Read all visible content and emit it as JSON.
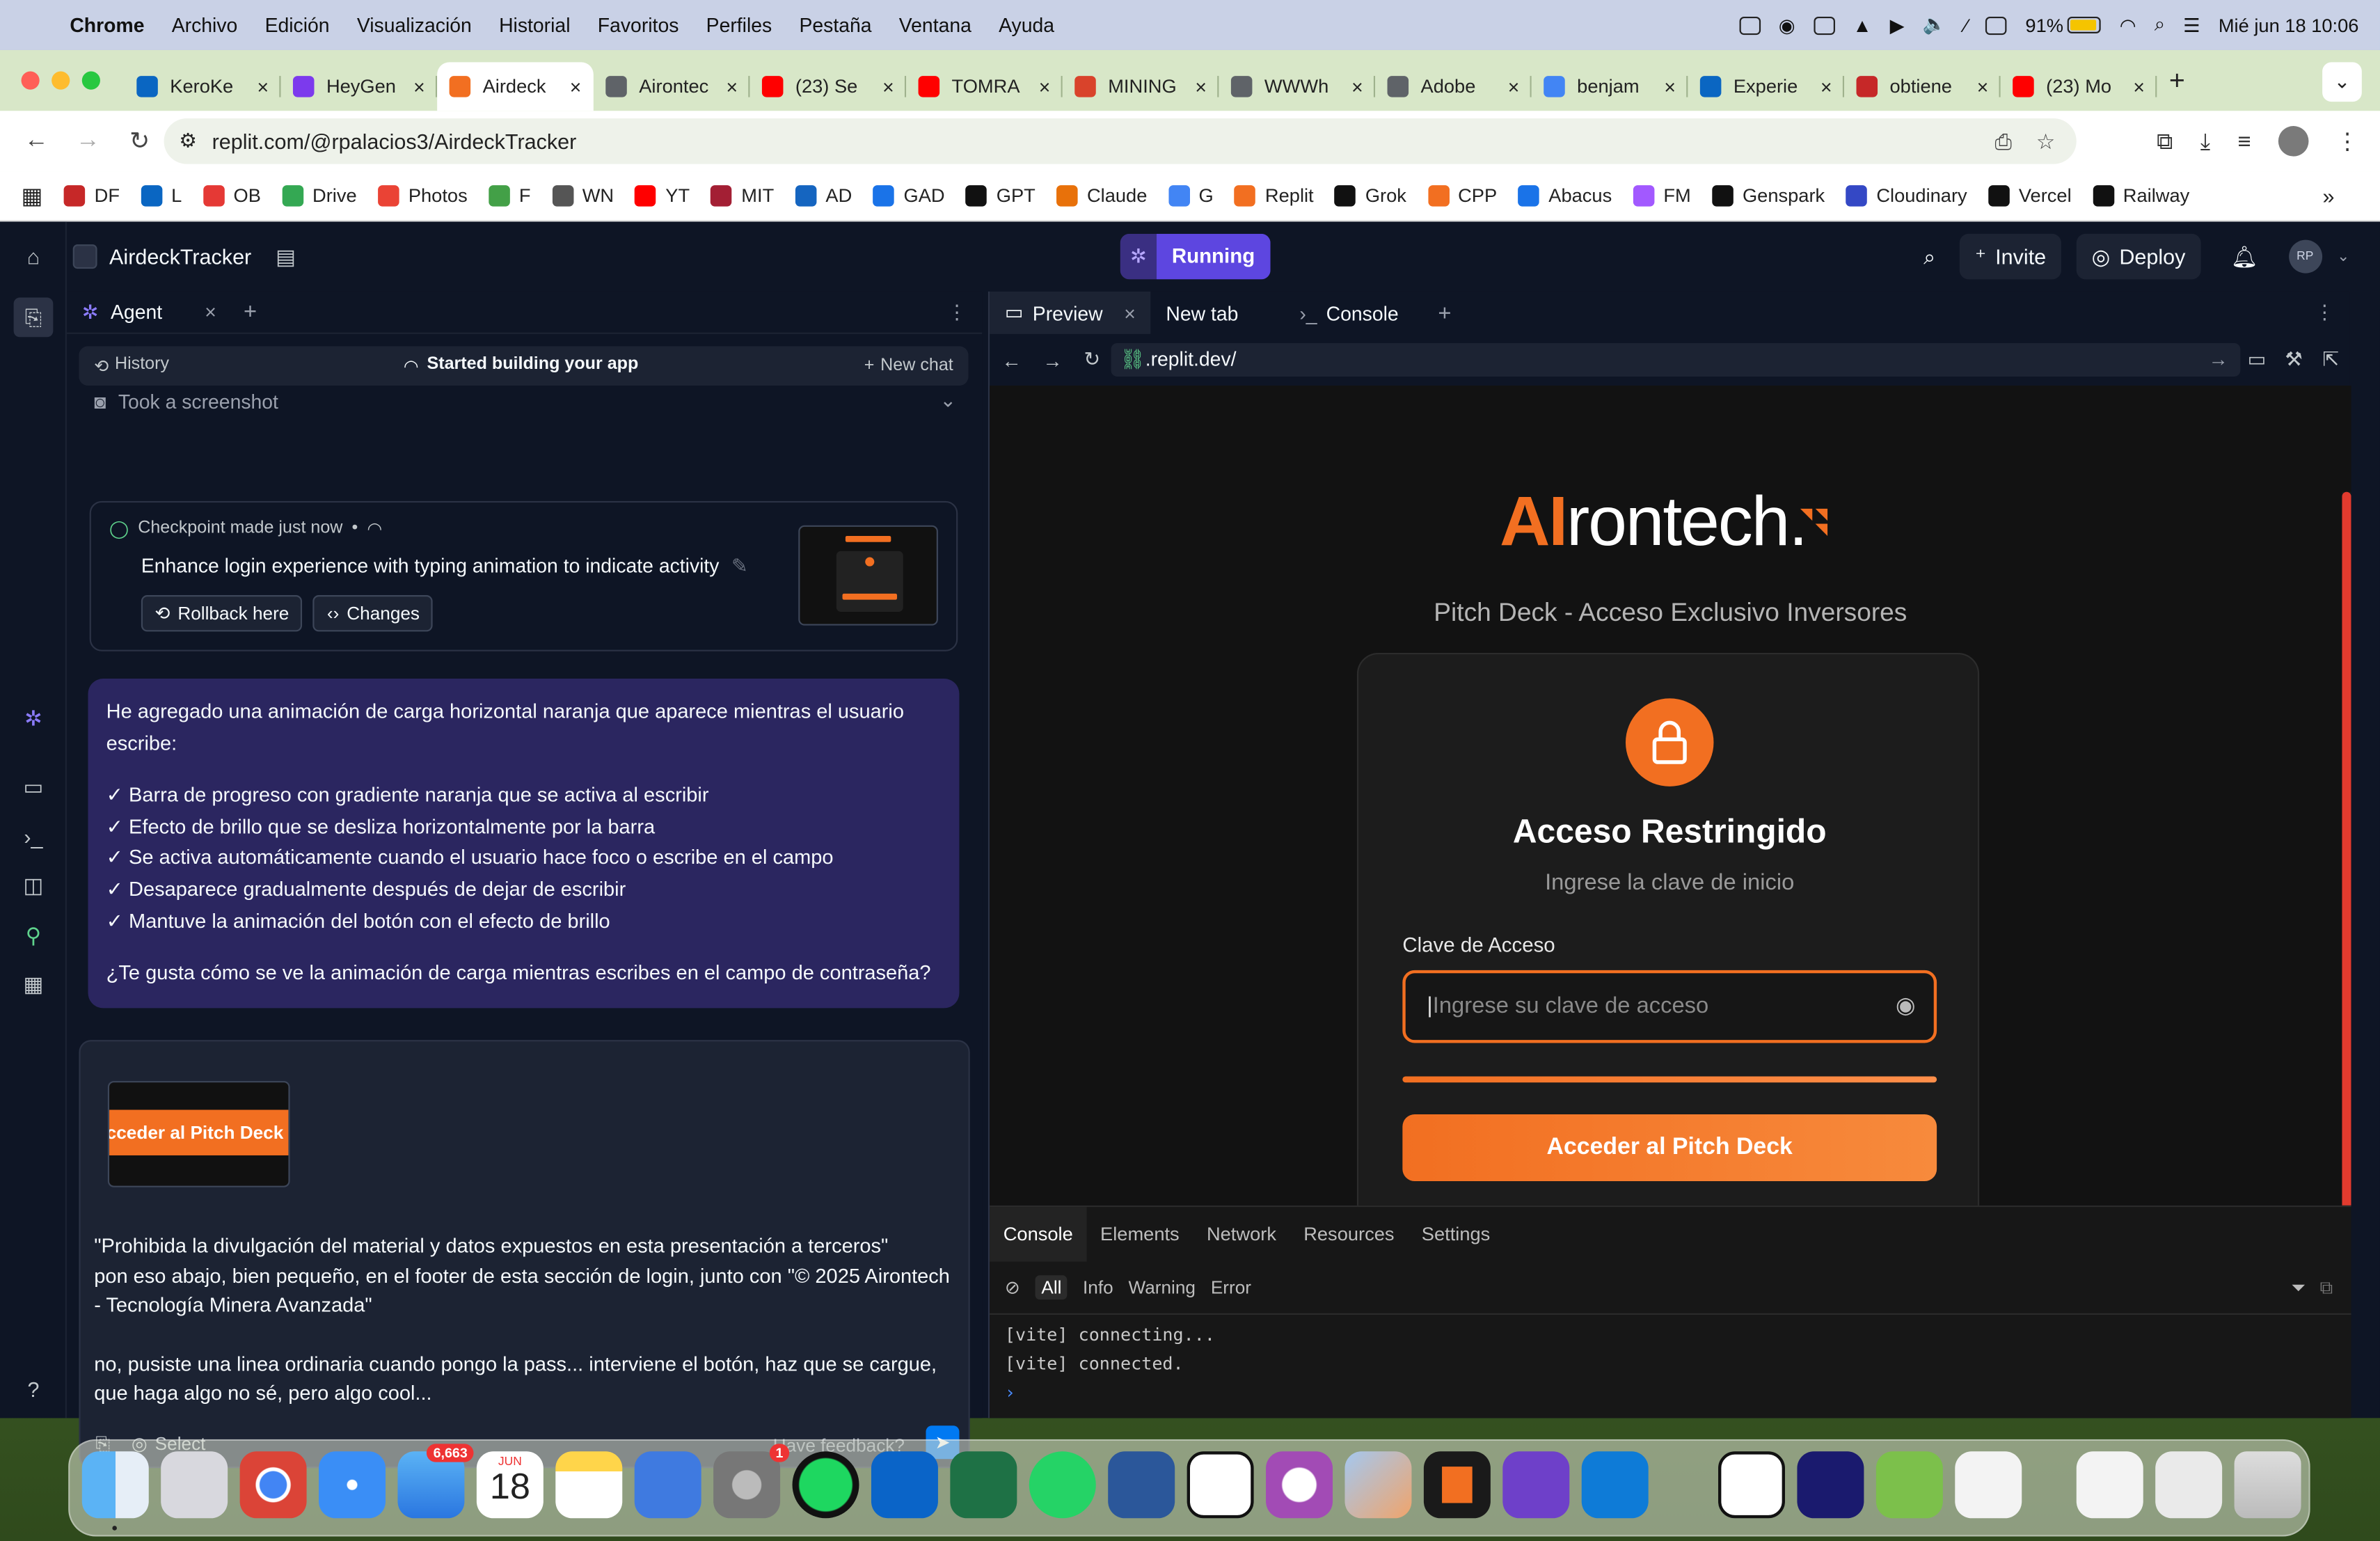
{
  "macbar": {
    "app": "Chrome",
    "menus": [
      "Archivo",
      "Edición",
      "Visualización",
      "Historial",
      "Favoritos",
      "Perfiles",
      "Pestaña",
      "Ventana",
      "Ayuda"
    ],
    "battery": "91%",
    "datetime": "Mié jun 18  10:06"
  },
  "browser": {
    "tabs": [
      {
        "label": "KeroKe",
        "color": "#0a66c2"
      },
      {
        "label": "HeyGen",
        "color": "#7c3aed"
      },
      {
        "label": "Airdeck",
        "color": "#f26f21"
      },
      {
        "label": "Airontec",
        "color": "#5f6368"
      },
      {
        "label": "(23) Se",
        "color": "#ff0000"
      },
      {
        "label": "TOMRA",
        "color": "#ff0000"
      },
      {
        "label": "MINING",
        "color": "#d9432b"
      },
      {
        "label": "WWWh",
        "color": "#5f6368"
      },
      {
        "label": "Adobe",
        "color": "#5f6368"
      },
      {
        "label": "benjam",
        "color": "#4285f4"
      },
      {
        "label": "Experie",
        "color": "#0a66c2"
      },
      {
        "label": "obtiene",
        "color": "#c62828"
      },
      {
        "label": "(23) Mo",
        "color": "#ff0000"
      }
    ],
    "url": "replit.com/@rpalacios3/AirdeckTracker",
    "bookmarks": [
      "DF",
      "L",
      "OB",
      "Drive",
      "Photos",
      "F",
      "WN",
      "YT",
      "MIT",
      "AD",
      "GAD",
      "GPT",
      "Claude",
      "G",
      "Replit",
      "Grok",
      "CPP",
      "Abacus",
      "FM",
      "Genspark",
      "Cloudinary",
      "Vercel",
      "Railway"
    ]
  },
  "replit": {
    "project": "AirdeckTracker",
    "status": "Running",
    "invite": "Invite",
    "deploy": "Deploy",
    "avatar": "RP",
    "agent": {
      "tab": "Agent",
      "history": "History",
      "started": "Started building your app",
      "new_chat": "New chat",
      "screenshot": "Took a screenshot",
      "checkpoint": "Checkpoint made just now",
      "checkpoint_title": "Enhance login experience with typing animation to indicate activity",
      "rollback": "Rollback here",
      "changes": "Changes",
      "message_intro": "He agregado una animación de carga horizontal naranja que aparece mientras el usuario escribe:",
      "message_items": [
        "✓ Barra de progreso con gradiente naranja que se activa al escribir",
        "✓ Efecto de brillo que se desliza horizontalmente por la barra",
        "✓ Se activa automáticamente cuando el usuario hace foco o escribe en el campo",
        "✓ Desaparece gradualmente después de dejar de escribir",
        "✓ Mantuve la animación del botón con el efecto de brillo"
      ],
      "message_question": "¿Te gusta cómo se ve la animación de carga mientras escribes en el campo de contraseña?",
      "attach_chip": "cceder al Pitch Deck",
      "input_p1": "\"Prohibida la divulgación del material y datos expuestos en esta presentación a terceros\"",
      "input_p2": "pon eso abajo, bien pequeño, en el footer de esta sección de login, junto con \"© 2025 Airontech - Tecnología Minera Avanzada\"",
      "input_p3": "no, pusiste una linea ordinaria cuando pongo la pass... interviene el botón, haz que se cargue, que haga algo no sé, pero algo cool...",
      "select": "Select",
      "feedback": "Have feedback?"
    },
    "preview": {
      "tabs": [
        "Preview",
        "New tab",
        "Console"
      ],
      "url": ".replit.dev/",
      "brand_ai": "AI",
      "brand_rest": "rontech.",
      "subtitle": "Pitch Deck - Acceso Exclusivo Inversores",
      "heading": "Acceso Restringido",
      "subheading": "Ingrese la clave de inicio",
      "field_label": "Clave de Acceso",
      "placeholder": "Ingrese su clave de acceso",
      "button": "Acceder al Pitch Deck"
    },
    "devtools": {
      "tabs": [
        "Console",
        "Elements",
        "Network",
        "Resources",
        "Settings"
      ],
      "filters": [
        "All",
        "Info",
        "Warning",
        "Error"
      ],
      "lines": [
        "[vite] connecting...",
        "[vite] connected."
      ]
    }
  },
  "dock": {
    "mail_badge": "6,663",
    "calendar_month": "JUN",
    "calendar_day": "18",
    "settings_badge": "1"
  }
}
